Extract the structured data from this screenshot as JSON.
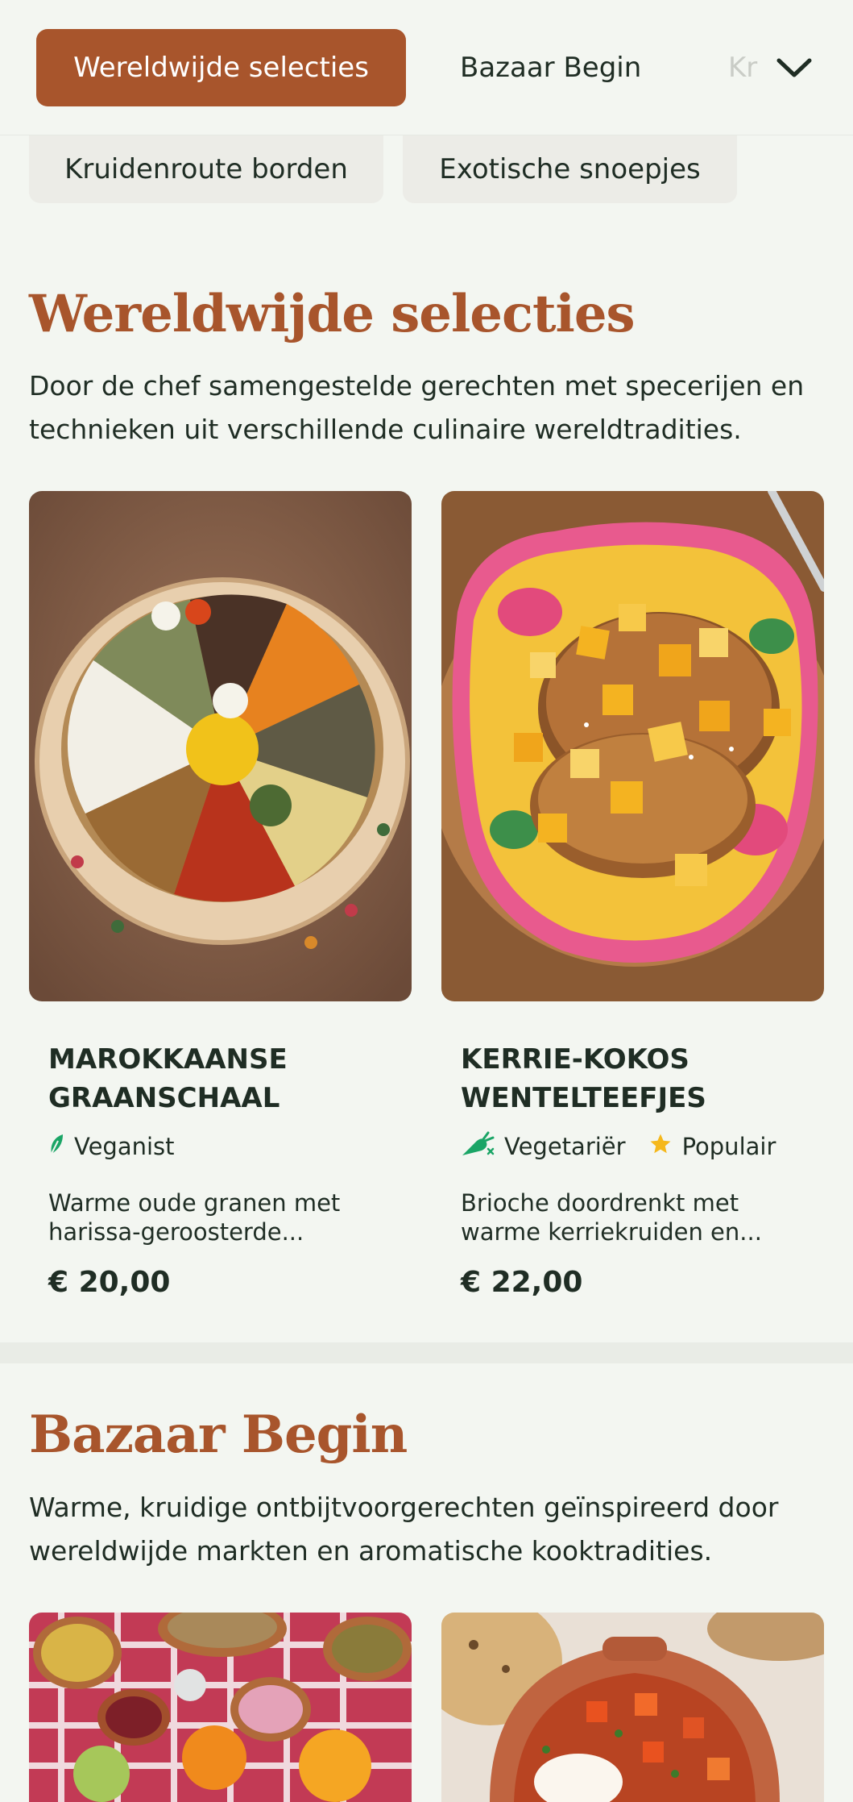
{
  "nav": {
    "tabs": [
      "Wereldwijde selecties",
      "Bazaar Begin",
      "Kr"
    ],
    "chips": [
      "Kruidenroute borden",
      "Exotische snoepjes"
    ]
  },
  "sections": [
    {
      "title": "Wereldwijde selecties",
      "description": "Door de chef samengestelde gerechten met specerijen en technieken uit verschillende culinaire wereldtradities.",
      "cards": [
        {
          "title": "MAROKKAANSE GRAANSCHAAL",
          "tags": [
            {
              "icon": "leaf-icon",
              "label": "Veganist"
            }
          ],
          "description": "Warme oude granen met harissa-geroosterde...",
          "price": "€ 20,00"
        },
        {
          "title": "KERRIE-KOKOS WENTELTEEFJES",
          "tags": [
            {
              "icon": "carrot-icon",
              "label": "Vegetariër"
            },
            {
              "icon": "star-icon",
              "label": "Populair"
            }
          ],
          "description": "Brioche doordrenkt met warme kerriekruiden en...",
          "price": "€ 22,00"
        }
      ]
    },
    {
      "title": "Bazaar Begin",
      "description": "Warme, kruidige ontbijtvoorgerechten geïnspireerd door wereldwijde markten en aromatische kooktradities."
    }
  ],
  "colors": {
    "accent": "#a8552c",
    "background": "#f3f6f1",
    "text": "#1f2d24",
    "vegan_green": "#1aa566",
    "star_yellow": "#f5b81c"
  }
}
